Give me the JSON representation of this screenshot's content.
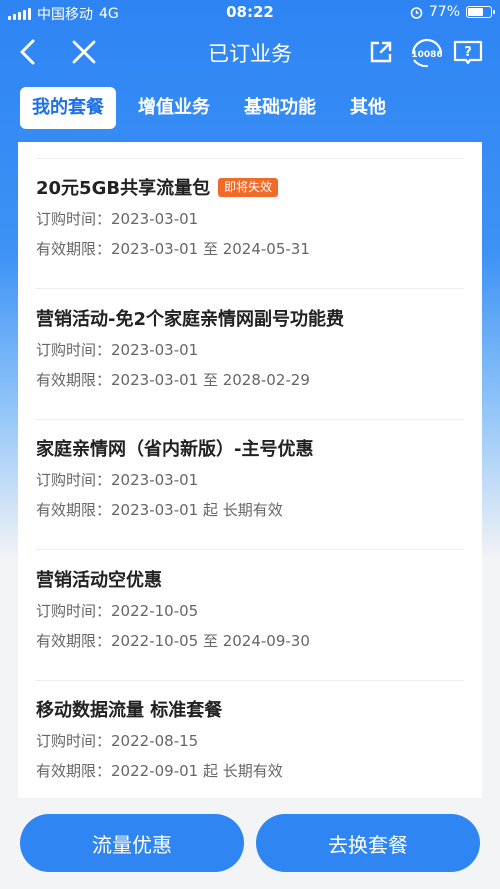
{
  "status_bar": {
    "carrier": "中国移动",
    "network": "4G",
    "time": "08:22",
    "battery": "77%",
    "battery_level": 0.77
  },
  "nav": {
    "title": "已订业务",
    "service_number": "10086"
  },
  "tabs": [
    {
      "label": "我的套餐",
      "active": true
    },
    {
      "label": "增值业务",
      "active": false
    },
    {
      "label": "基础功能",
      "active": false
    },
    {
      "label": "其他",
      "active": false
    }
  ],
  "packages": [
    {
      "name": "20元5GB共享流量包",
      "badge": "即将失效",
      "order_label": "订购时间：",
      "order_date": "2023-03-01",
      "valid_label": "有效期限：",
      "valid_period": "2023-03-01 至 2024-05-31"
    },
    {
      "name": "营销活动-免2个家庭亲情网副号功能费",
      "badge": "",
      "order_label": "订购时间：",
      "order_date": "2023-03-01",
      "valid_label": "有效期限：",
      "valid_period": "2023-03-01 至 2028-02-29"
    },
    {
      "name": "家庭亲情网（省内新版）-主号优惠",
      "badge": "",
      "order_label": "订购时间：",
      "order_date": "2023-03-01",
      "valid_label": "有效期限：",
      "valid_period": "2023-03-01 起 长期有效"
    },
    {
      "name": "营销活动空优惠",
      "badge": "",
      "order_label": "订购时间：",
      "order_date": "2022-10-05",
      "valid_label": "有效期限：",
      "valid_period": "2022-10-05 至 2024-09-30"
    },
    {
      "name": "移动数据流量 标准套餐",
      "badge": "",
      "order_label": "订购时间：",
      "order_date": "2022-08-15",
      "valid_label": "有效期限：",
      "valid_period": "2022-09-01 起 长期有效"
    }
  ],
  "buttons": {
    "left": "流量优惠",
    "right": "去换套餐"
  },
  "colors": {
    "primary": "#2f86f2",
    "badge": "#f06a2a",
    "active_tab_text": "#1f6fe6"
  }
}
